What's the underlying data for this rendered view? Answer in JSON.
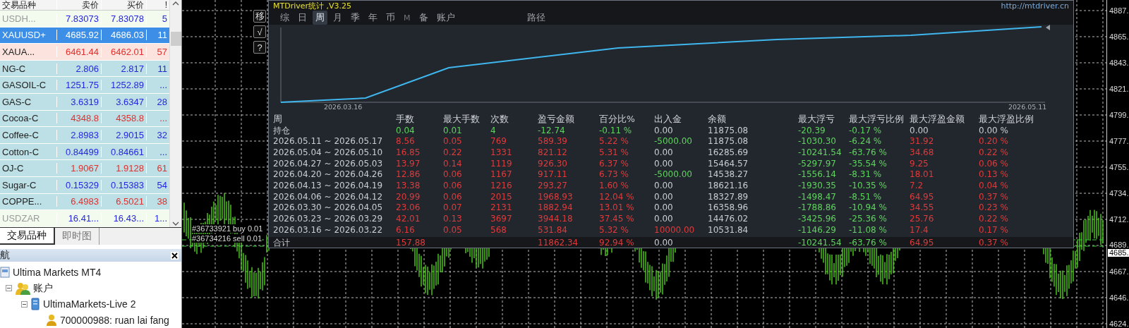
{
  "market_watch": {
    "columns": [
      "交易品种",
      "卖价",
      "买价",
      "!"
    ],
    "rows": [
      {
        "symbol": "USDH...",
        "bid": "7.83073",
        "ask": "7.83078",
        "spread": "5",
        "selected": false,
        "disabled": true,
        "highlighted": false,
        "color": "#2525e0"
      },
      {
        "symbol": "XAUUSD+",
        "bid": "4685.92",
        "ask": "4686.03",
        "spread": "11",
        "selected": true,
        "disabled": false
      },
      {
        "symbol": "XAUA...",
        "bid": "6461.44",
        "ask": "6462.01",
        "spread": "57",
        "selected": false,
        "disabled": false,
        "highlighted": true,
        "color": "#e0302e"
      },
      {
        "symbol": "NG-C",
        "bid": "2.806",
        "ask": "2.817",
        "spread": "11",
        "selected": false,
        "disabled": false,
        "highlighted": false,
        "color": "#2525e0"
      },
      {
        "symbol": "GASOIL-C",
        "bid": "1251.75",
        "ask": "1252.89",
        "spread": "...",
        "selected": false,
        "disabled": false,
        "highlighted": false,
        "color": "#2525e0"
      },
      {
        "symbol": "GAS-C",
        "bid": "3.6319",
        "ask": "3.6347",
        "spread": "28",
        "selected": false,
        "disabled": false,
        "highlighted": false,
        "color": "#2525e0"
      },
      {
        "symbol": "Cocoa-C",
        "bid": "4348.8",
        "ask": "4358.8",
        "spread": "...",
        "selected": false,
        "disabled": false,
        "highlighted": false,
        "color": "#e0302e"
      },
      {
        "symbol": "Coffee-C",
        "bid": "2.8983",
        "ask": "2.9015",
        "spread": "32",
        "selected": false,
        "disabled": false,
        "highlighted": false,
        "color": "#2525e0"
      },
      {
        "symbol": "Cotton-C",
        "bid": "0.84499",
        "ask": "0.84661",
        "spread": "...",
        "selected": false,
        "disabled": false,
        "highlighted": false,
        "color": "#2525e0"
      },
      {
        "symbol": "OJ-C",
        "bid": "1.9067",
        "ask": "1.9128",
        "spread": "61",
        "selected": false,
        "disabled": false,
        "highlighted": false,
        "color": "#e0302e"
      },
      {
        "symbol": "Sugar-C",
        "bid": "0.15329",
        "ask": "0.15383",
        "spread": "54",
        "selected": false,
        "disabled": false,
        "highlighted": false,
        "color": "#2525e0"
      },
      {
        "symbol": "COPPE...",
        "bid": "6.4983",
        "ask": "6.5021",
        "spread": "38",
        "selected": false,
        "disabled": false,
        "highlighted": false,
        "color": "#e0302e"
      },
      {
        "symbol": "USDZAR",
        "bid": "16.41...",
        "ask": "16.43...",
        "spread": "1...",
        "selected": false,
        "disabled": true,
        "highlighted": false,
        "color": "#2525e0"
      }
    ],
    "tabs": [
      {
        "label": "交易品种",
        "selected": true
      },
      {
        "label": "即时图",
        "selected": false
      }
    ]
  },
  "navigator": {
    "title": "航",
    "tree": [
      {
        "label": "Ultima Markets MT4",
        "kind": "terminal",
        "children": [
          {
            "label": "账户",
            "kind": "accounts",
            "expanded": true,
            "children": [
              {
                "label": "UltimaMarkets-Live 2",
                "kind": "server",
                "expanded": true,
                "children": [
                  {
                    "label": "700000988: ruan lai fang",
                    "kind": "user"
                  }
                ]
              }
            ]
          }
        ]
      }
    ]
  },
  "chart": {
    "price_labels": [
      "4887.",
      "4865.",
      "4843.",
      "4821.",
      "4799.",
      "4777.",
      "4755.",
      "4734.",
      "4712.",
      "4689.",
      "4667.",
      "4646.",
      "4624."
    ],
    "current_price": "4685.",
    "orders": [
      "#36733921 buy 0.01",
      "#36734216 sell 0.01"
    ],
    "tool_buttons": [
      "移",
      "√",
      "?"
    ]
  },
  "stats": {
    "title": "MTDriver统计 ,V3.25",
    "link": "http://mtdriver.cn",
    "tabs": [
      {
        "label": "综",
        "selected": false,
        "disabled": false
      },
      {
        "label": "日",
        "selected": false,
        "disabled": false
      },
      {
        "label": "周",
        "selected": true,
        "disabled": false
      },
      {
        "label": "月",
        "selected": false,
        "disabled": false
      },
      {
        "label": "季",
        "selected": false,
        "disabled": false
      },
      {
        "label": "年",
        "selected": false,
        "disabled": false
      },
      {
        "label": "币",
        "selected": false,
        "disabled": false
      },
      {
        "label": "M",
        "selected": false,
        "disabled": true
      },
      {
        "label": "备",
        "selected": false,
        "disabled": false
      },
      {
        "label": "账户",
        "selected": false,
        "disabled": false
      }
    ],
    "path_button": "路径",
    "equity_chart": {
      "start_label": "2026.03.16",
      "end_label": "2026.05.11"
    },
    "columns": [
      "周",
      "手数",
      "最大手数",
      "次数",
      "盈亏金额",
      "百分比%",
      "出入金",
      "余额",
      "最大浮亏",
      "最大浮亏比例",
      "最大浮盈金额",
      "最大浮盈比例"
    ],
    "rows": [
      {
        "total": false,
        "cells": [
          {
            "text": "持仓"
          },
          {
            "text": "0.04",
            "color": "#5fd35f"
          },
          {
            "text": "0.01",
            "color": "#5fd35f"
          },
          {
            "text": "4",
            "color": "#5fd35f"
          },
          {
            "text": "-12.74",
            "color": "#5fd35f"
          },
          {
            "text": "-0.11 %",
            "color": "#5fd35f"
          },
          {
            "text": "0.00",
            "color": "#c8ccd4"
          },
          {
            "text": "11875.08",
            "color": "#c8ccd4"
          },
          {
            "text": "-20.39",
            "color": "#5fd35f"
          },
          {
            "text": "-0.17 %",
            "color": "#5fd35f"
          },
          {
            "text": "0.00",
            "color": "#c8ccd4"
          },
          {
            "text": "0.00 %",
            "color": "#c8ccd4"
          }
        ]
      },
      {
        "total": false,
        "cells": [
          {
            "text": "2026.05.11 ~ 2026.05.17"
          },
          {
            "text": "8.56",
            "color": "#e03a3a"
          },
          {
            "text": "0.05",
            "color": "#e03a3a"
          },
          {
            "text": "769",
            "color": "#e03a3a"
          },
          {
            "text": "589.39",
            "color": "#e03a3a"
          },
          {
            "text": "5.22 %",
            "color": "#e03a3a"
          },
          {
            "text": "-5000.00",
            "color": "#5fd35f"
          },
          {
            "text": "11875.08",
            "color": "#c8ccd4"
          },
          {
            "text": "-1030.30",
            "color": "#5fd35f"
          },
          {
            "text": "-6.24 %",
            "color": "#5fd35f"
          },
          {
            "text": "31.92",
            "color": "#e03a3a"
          },
          {
            "text": "0.20 %",
            "color": "#e03a3a"
          }
        ]
      },
      {
        "total": false,
        "cells": [
          {
            "text": "2026.05.04 ~ 2026.05.10"
          },
          {
            "text": "16.85",
            "color": "#e03a3a"
          },
          {
            "text": "0.22",
            "color": "#e03a3a"
          },
          {
            "text": "1331",
            "color": "#e03a3a"
          },
          {
            "text": "821.12",
            "color": "#e03a3a"
          },
          {
            "text": "5.31 %",
            "color": "#e03a3a"
          },
          {
            "text": "0.00",
            "color": "#c8ccd4"
          },
          {
            "text": "16285.69",
            "color": "#c8ccd4"
          },
          {
            "text": "-10241.54",
            "color": "#5fd35f"
          },
          {
            "text": "-63.76 %",
            "color": "#5fd35f"
          },
          {
            "text": "34.68",
            "color": "#e03a3a"
          },
          {
            "text": "0.22 %",
            "color": "#e03a3a"
          }
        ]
      },
      {
        "total": false,
        "cells": [
          {
            "text": "2026.04.27 ~ 2026.05.03"
          },
          {
            "text": "13.97",
            "color": "#e03a3a"
          },
          {
            "text": "0.14",
            "color": "#e03a3a"
          },
          {
            "text": "1119",
            "color": "#e03a3a"
          },
          {
            "text": "926.30",
            "color": "#e03a3a"
          },
          {
            "text": "6.37 %",
            "color": "#e03a3a"
          },
          {
            "text": "0.00",
            "color": "#c8ccd4"
          },
          {
            "text": "15464.57",
            "color": "#c8ccd4"
          },
          {
            "text": "-5297.97",
            "color": "#5fd35f"
          },
          {
            "text": "-35.54 %",
            "color": "#5fd35f"
          },
          {
            "text": "9.25",
            "color": "#e03a3a"
          },
          {
            "text": "0.06 %",
            "color": "#e03a3a"
          }
        ]
      },
      {
        "total": false,
        "cells": [
          {
            "text": "2026.04.20 ~ 2026.04.26"
          },
          {
            "text": "12.86",
            "color": "#e03a3a"
          },
          {
            "text": "0.06",
            "color": "#e03a3a"
          },
          {
            "text": "1167",
            "color": "#e03a3a"
          },
          {
            "text": "917.11",
            "color": "#e03a3a"
          },
          {
            "text": "6.73 %",
            "color": "#e03a3a"
          },
          {
            "text": "-5000.00",
            "color": "#5fd35f"
          },
          {
            "text": "14538.27",
            "color": "#c8ccd4"
          },
          {
            "text": "-1556.14",
            "color": "#5fd35f"
          },
          {
            "text": "-8.31 %",
            "color": "#5fd35f"
          },
          {
            "text": "18.01",
            "color": "#e03a3a"
          },
          {
            "text": "0.13 %",
            "color": "#e03a3a"
          }
        ]
      },
      {
        "total": false,
        "cells": [
          {
            "text": "2026.04.13 ~ 2026.04.19"
          },
          {
            "text": "13.38",
            "color": "#e03a3a"
          },
          {
            "text": "0.06",
            "color": "#e03a3a"
          },
          {
            "text": "1216",
            "color": "#e03a3a"
          },
          {
            "text": "293.27",
            "color": "#e03a3a"
          },
          {
            "text": "1.60 %",
            "color": "#e03a3a"
          },
          {
            "text": "0.00",
            "color": "#c8ccd4"
          },
          {
            "text": "18621.16",
            "color": "#c8ccd4"
          },
          {
            "text": "-1930.35",
            "color": "#5fd35f"
          },
          {
            "text": "-10.35 %",
            "color": "#5fd35f"
          },
          {
            "text": "7.2",
            "color": "#e03a3a"
          },
          {
            "text": "0.04 %",
            "color": "#e03a3a"
          }
        ]
      },
      {
        "total": false,
        "cells": [
          {
            "text": "2026.04.06 ~ 2026.04.12"
          },
          {
            "text": "20.99",
            "color": "#e03a3a"
          },
          {
            "text": "0.06",
            "color": "#e03a3a"
          },
          {
            "text": "2015",
            "color": "#e03a3a"
          },
          {
            "text": "1968.93",
            "color": "#e03a3a"
          },
          {
            "text": "12.04 %",
            "color": "#e03a3a"
          },
          {
            "text": "0.00",
            "color": "#c8ccd4"
          },
          {
            "text": "18327.89",
            "color": "#c8ccd4"
          },
          {
            "text": "-1498.47",
            "color": "#5fd35f"
          },
          {
            "text": "-8.51 %",
            "color": "#5fd35f"
          },
          {
            "text": "64.95",
            "color": "#e03a3a"
          },
          {
            "text": "0.37 %",
            "color": "#e03a3a"
          }
        ]
      },
      {
        "total": false,
        "cells": [
          {
            "text": "2026.03.30 ~ 2026.04.05"
          },
          {
            "text": "23.06",
            "color": "#e03a3a"
          },
          {
            "text": "0.07",
            "color": "#e03a3a"
          },
          {
            "text": "2131",
            "color": "#e03a3a"
          },
          {
            "text": "1882.94",
            "color": "#e03a3a"
          },
          {
            "text": "13.01 %",
            "color": "#e03a3a"
          },
          {
            "text": "0.00",
            "color": "#c8ccd4"
          },
          {
            "text": "16358.96",
            "color": "#c8ccd4"
          },
          {
            "text": "-1788.86",
            "color": "#5fd35f"
          },
          {
            "text": "-10.94 %",
            "color": "#5fd35f"
          },
          {
            "text": "34.55",
            "color": "#e03a3a"
          },
          {
            "text": "0.23 %",
            "color": "#e03a3a"
          }
        ]
      },
      {
        "total": false,
        "cells": [
          {
            "text": "2026.03.23 ~ 2026.03.29"
          },
          {
            "text": "42.01",
            "color": "#e03a3a"
          },
          {
            "text": "0.13",
            "color": "#e03a3a"
          },
          {
            "text": "3697",
            "color": "#e03a3a"
          },
          {
            "text": "3944.18",
            "color": "#e03a3a"
          },
          {
            "text": "37.45 %",
            "color": "#e03a3a"
          },
          {
            "text": "0.00",
            "color": "#c8ccd4"
          },
          {
            "text": "14476.02",
            "color": "#c8ccd4"
          },
          {
            "text": "-3425.96",
            "color": "#5fd35f"
          },
          {
            "text": "-25.36 %",
            "color": "#5fd35f"
          },
          {
            "text": "25.76",
            "color": "#e03a3a"
          },
          {
            "text": "0.22 %",
            "color": "#e03a3a"
          }
        ]
      },
      {
        "total": false,
        "cells": [
          {
            "text": "2026.03.16 ~ 2026.03.22"
          },
          {
            "text": "6.16",
            "color": "#e03a3a"
          },
          {
            "text": "0.05",
            "color": "#e03a3a"
          },
          {
            "text": "568",
            "color": "#e03a3a"
          },
          {
            "text": "531.84",
            "color": "#e03a3a"
          },
          {
            "text": "5.32 %",
            "color": "#e03a3a"
          },
          {
            "text": "10000.00",
            "color": "#e03a3a"
          },
          {
            "text": "10531.84",
            "color": "#c8ccd4"
          },
          {
            "text": "-1146.29",
            "color": "#5fd35f"
          },
          {
            "text": "-11.08 %",
            "color": "#5fd35f"
          },
          {
            "text": "17.4",
            "color": "#e03a3a"
          },
          {
            "text": "0.17 %",
            "color": "#e03a3a"
          }
        ]
      },
      {
        "total": true,
        "cells": [
          {
            "text": "合计"
          },
          {
            "text": "157.88",
            "color": "#e03a3a"
          },
          null,
          null,
          {
            "text": "11862.34",
            "color": "#e03a3a"
          },
          {
            "text": "92.94 %",
            "color": "#e03a3a"
          },
          {
            "text": "0.00",
            "color": "#c8ccd4"
          },
          null,
          {
            "text": "-10241.54",
            "color": "#5fd35f"
          },
          {
            "text": "-63.76 %",
            "color": "#5fd35f"
          },
          {
            "text": "64.95",
            "color": "#e03a3a"
          },
          {
            "text": "0.37 %",
            "color": "#e03a3a"
          }
        ]
      }
    ]
  }
}
